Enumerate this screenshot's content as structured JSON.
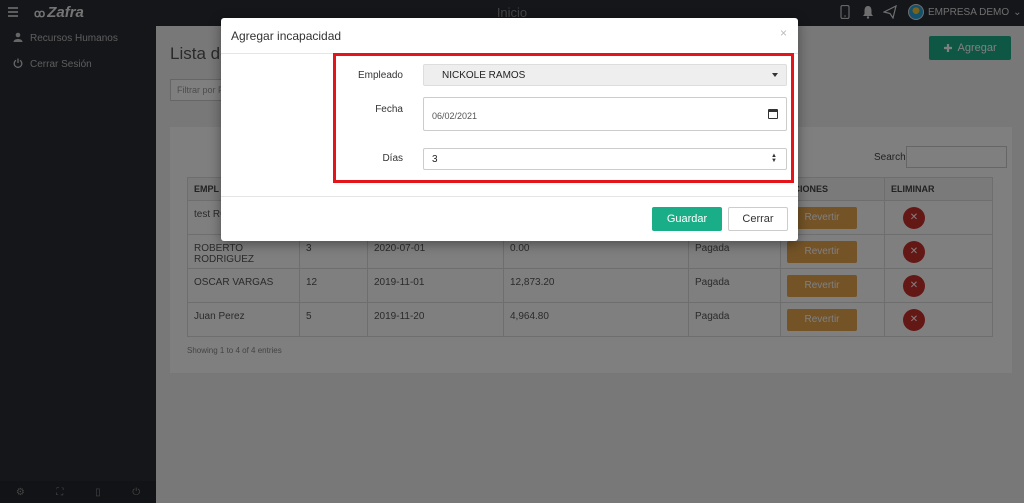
{
  "topbar": {
    "logo": "Zafra",
    "center_title": "Inicio",
    "company_name": "EMPRESA DEMO",
    "icons": [
      "menu-icon",
      "phone-icon",
      "bell-icon",
      "send-icon"
    ]
  },
  "sidebar": {
    "items": [
      {
        "label": "Recursos Humanos",
        "icon": "user-icon"
      },
      {
        "label": "Cerrar Sesión",
        "icon": "power-icon"
      }
    ],
    "footer_icons": [
      "settings-icon",
      "expand-icon",
      "lock-icon",
      "power-icon"
    ]
  },
  "page": {
    "title": "Lista de",
    "add_button": "Agregar",
    "filter_placeholder": "Filtrar por F",
    "search_label": "Search:",
    "columns": [
      "EMPL",
      "",
      "",
      "",
      "",
      "CCIONES",
      "ELIMINAR"
    ],
    "rows": [
      {
        "name": "test RO",
        "days": "",
        "date": "",
        "amount": "",
        "status": "",
        "action": "Revertir"
      },
      {
        "name": "ROBERTO RODRIGUEZ",
        "days": "3",
        "date": "2020-07-01",
        "amount": "0.00",
        "status": "Pagada",
        "action": "Revertir"
      },
      {
        "name": "OSCAR VARGAS",
        "days": "12",
        "date": "2019-11-01",
        "amount": "12,873.20",
        "status": "Pagada",
        "action": "Revertir"
      },
      {
        "name": "Juan Perez",
        "days": "5",
        "date": "2019-11-20",
        "amount": "4,964.80",
        "status": "Pagada",
        "action": "Revertir"
      }
    ],
    "showing": "Showing 1 to 4 of 4 entries"
  },
  "modal": {
    "title": "Agregar incapacidad",
    "close_symbol": "×",
    "employee_label": "Empleado",
    "employee_value": "NICKOLE RAMOS",
    "date_label": "Fecha",
    "date_value": "06/02/2021",
    "days_label": "Días",
    "days_value": "3",
    "save_button": "Guardar",
    "close_button": "Cerrar"
  },
  "colors": {
    "primary": "#1aae88",
    "warning": "#e8a64f",
    "danger": "#c9302c",
    "highlight": "#e5141b",
    "dark": "#2a2d34"
  }
}
